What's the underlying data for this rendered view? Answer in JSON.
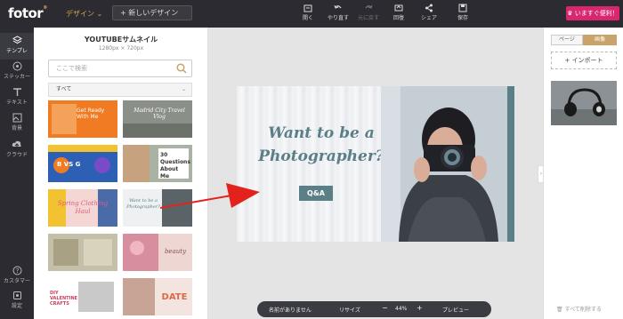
{
  "app": {
    "logo": "fotor"
  },
  "topbar": {
    "design_menu": "デザイン",
    "new_design": "新しいデザイン",
    "tools": [
      {
        "label": "開く",
        "icon": "folder-icon"
      },
      {
        "label": "やり直す",
        "icon": "undo-icon"
      },
      {
        "label": "元に戻す",
        "icon": "redo-icon"
      },
      {
        "label": "回復",
        "icon": "restore-icon"
      },
      {
        "label": "シェア",
        "icon": "share-icon"
      },
      {
        "label": "保存",
        "icon": "save-icon"
      }
    ],
    "upgrade": "いますぐ便利！"
  },
  "leftnav": [
    {
      "label": "テンプレ",
      "icon": "template-icon",
      "active": true
    },
    {
      "label": "ステッカー",
      "icon": "sticker-icon"
    },
    {
      "label": "テキスト",
      "icon": "text-icon"
    },
    {
      "label": "背景",
      "icon": "background-icon"
    },
    {
      "label": "クラウド",
      "icon": "cloud-icon"
    },
    {
      "label": "カスタマー",
      "icon": "help-icon"
    },
    {
      "label": "設定",
      "icon": "settings-icon"
    }
  ],
  "panel": {
    "title": "YOUTUBEサムネイル",
    "size": "1280px × 720px",
    "search_placeholder": "ここで検索",
    "filter": "すべて",
    "thumbs": [
      {
        "text": "Get Ready With Me"
      },
      {
        "text": "Madrid City Travel Vlog"
      },
      {
        "text": "B VS G"
      },
      {
        "text": "30 Questions About Me"
      },
      {
        "text": "Spring Clothing Haul"
      },
      {
        "text": "Want to be a Photographer?"
      },
      {
        "text": ""
      },
      {
        "text": "beauty"
      },
      {
        "text": "DIY VALENTINE CRAFTS"
      },
      {
        "text": "DATE"
      }
    ]
  },
  "canvas": {
    "headline": "Want to be a Photographer?",
    "badge": "Q&A"
  },
  "bottombar": {
    "name": "名前がありません",
    "resize": "リサイズ",
    "minus": "−",
    "zoom": "44%",
    "plus": "+",
    "preview": "プレビュー"
  },
  "rightpanel": {
    "tab_page": "ページ",
    "tab_image": "画像",
    "import": "+ インポート",
    "delete_all": "すべて削除する"
  },
  "colors": {
    "accent_teal": "#5a7f86",
    "upgrade_pink": "#d8266f",
    "tab_gold": "#c9a36a",
    "arrow_red": "#e3231b"
  }
}
